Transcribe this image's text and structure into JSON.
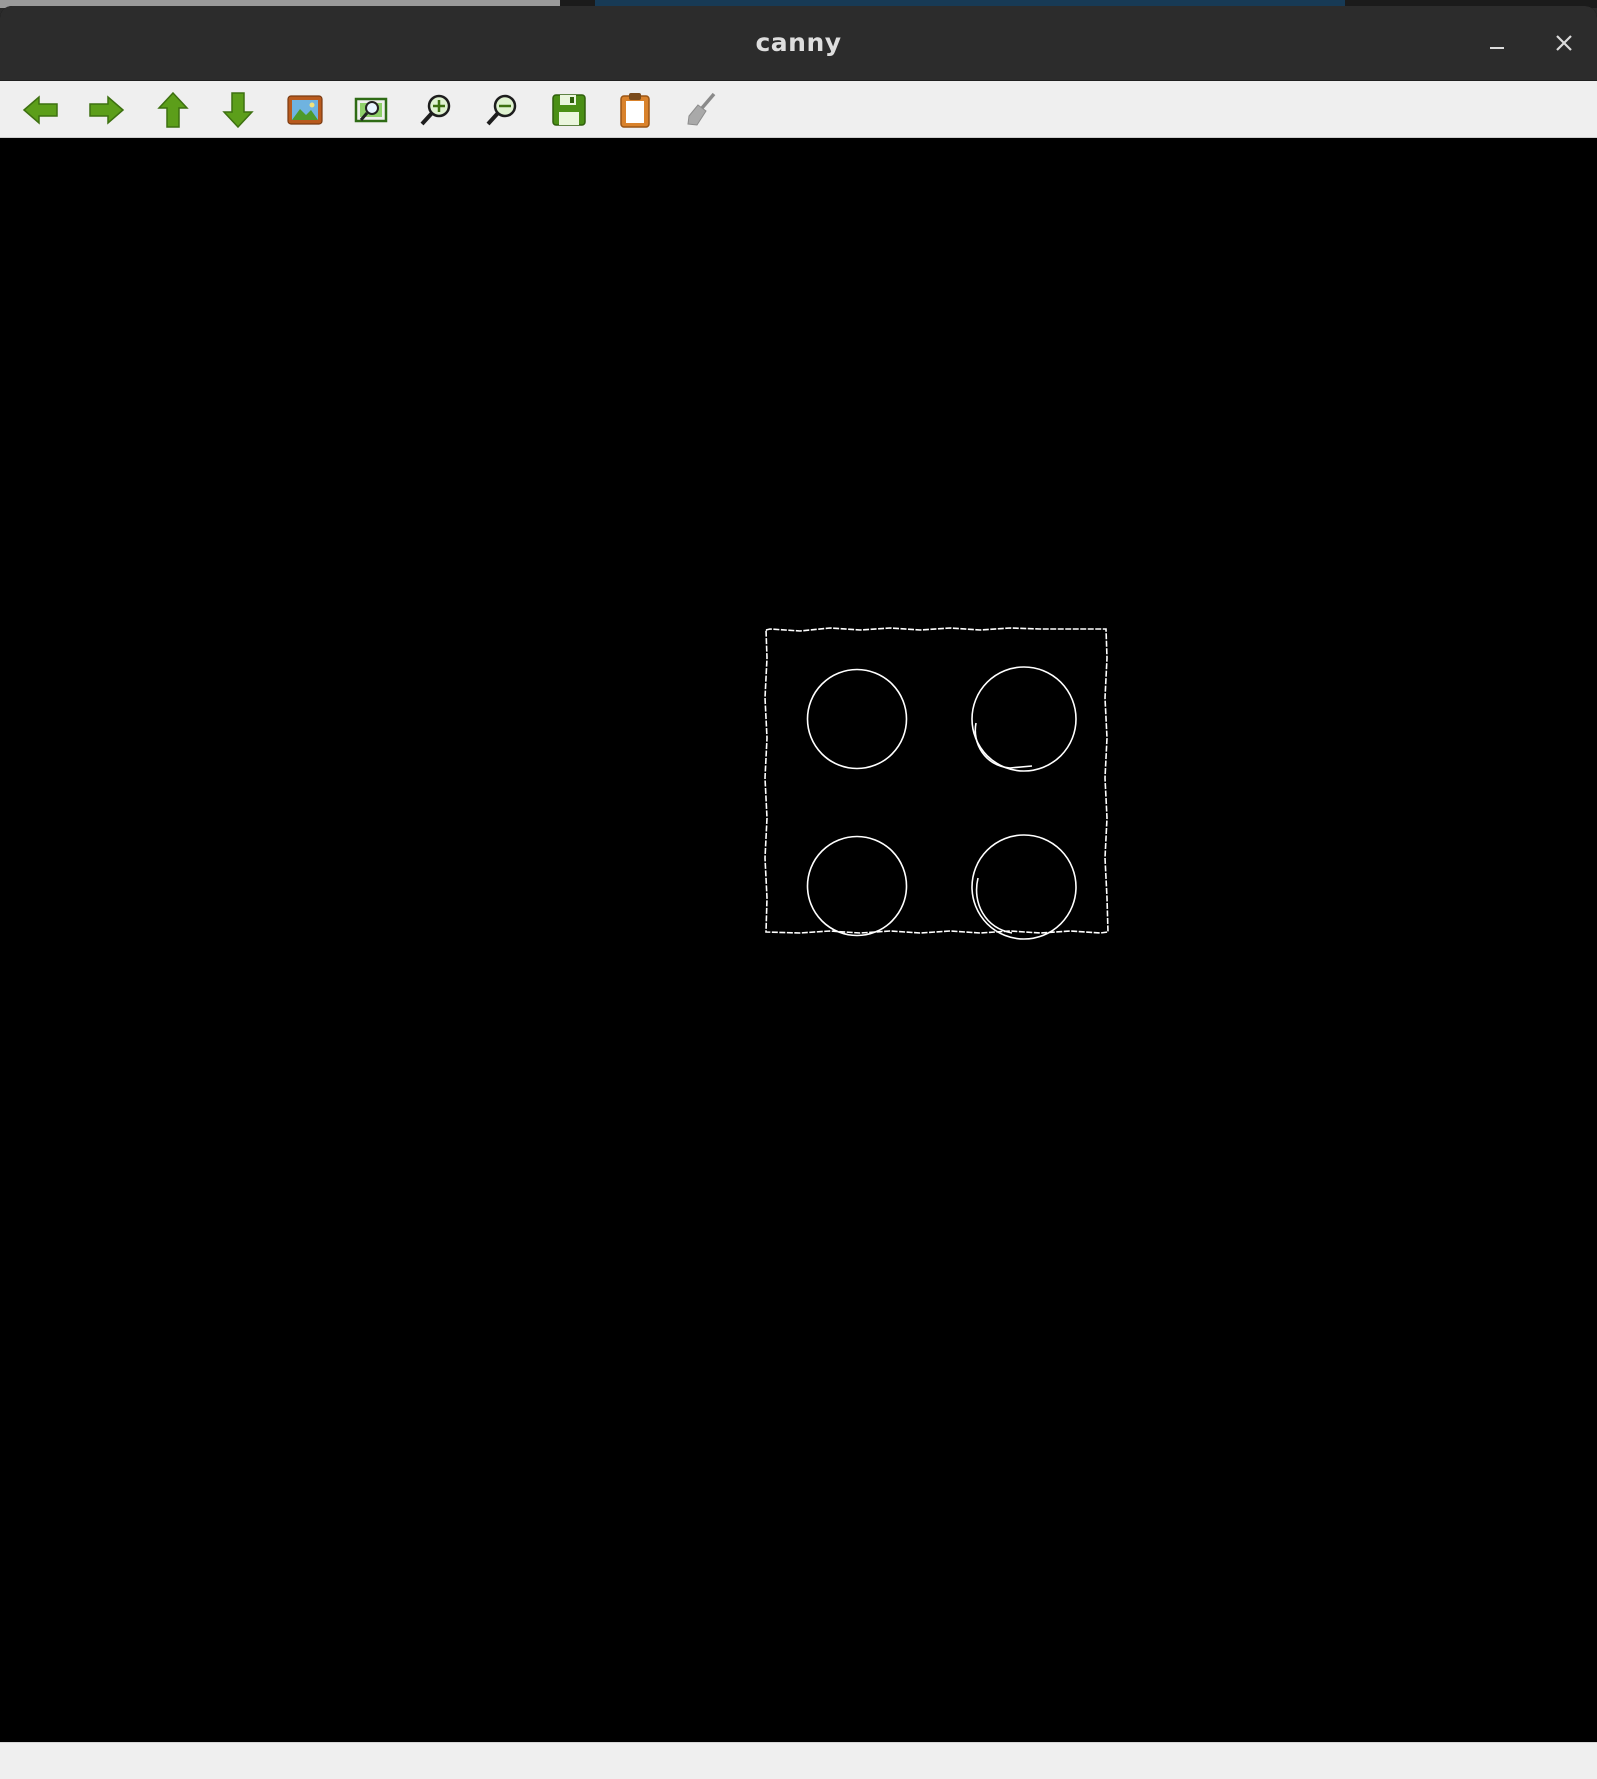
{
  "window": {
    "title": "canny"
  },
  "toolbar": {
    "buttons": [
      {
        "name": "pan-left-button",
        "icon": "arrow-left-icon"
      },
      {
        "name": "pan-right-button",
        "icon": "arrow-right-icon"
      },
      {
        "name": "pan-up-button",
        "icon": "arrow-up-icon"
      },
      {
        "name": "pan-down-button",
        "icon": "arrow-down-icon"
      },
      {
        "name": "zoom-original-button",
        "icon": "image-icon"
      },
      {
        "name": "zoom-fit-button",
        "icon": "zoom-fit-icon"
      },
      {
        "name": "zoom-in-button",
        "icon": "zoom-in-icon"
      },
      {
        "name": "zoom-out-button",
        "icon": "zoom-out-icon"
      },
      {
        "name": "save-button",
        "icon": "floppy-disk-icon"
      },
      {
        "name": "copy-clipboard-button",
        "icon": "clipboard-icon"
      },
      {
        "name": "properties-button",
        "icon": "brush-icon"
      }
    ],
    "colors": {
      "arrow": "#5c9e1a",
      "arrow_dark": "#3d7010",
      "image_frame": "#b85a1e",
      "clipboard": "#d9822b",
      "disabled": "#a0a0a0"
    }
  },
  "canvas": {
    "background": "#000000",
    "edge_color": "#ffffff"
  },
  "statusbar": {
    "text": ""
  }
}
